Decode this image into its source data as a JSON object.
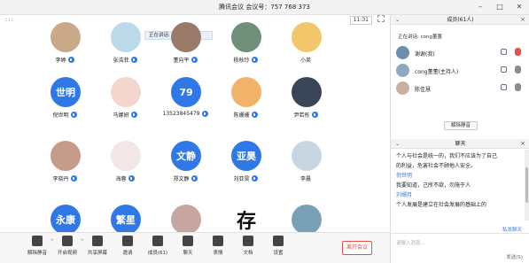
{
  "window": {
    "title": "腾讯会议 会议号：757 768 373",
    "controls": [
      "minimize-icon",
      "maximize-icon",
      "close-icon"
    ]
  },
  "video": {
    "time": "11:31",
    "speaking_bubble": "正在讲话: cong董董",
    "participants": [
      {
        "name": "李婷",
        "initial": "",
        "color": "#c9a98a",
        "mic": true
      },
      {
        "name": "张浩菲",
        "initial": "",
        "color": "#bcd9e8",
        "mic": true
      },
      {
        "name": "董向平",
        "initial": "",
        "color": "#9a7b6a",
        "mic": true
      },
      {
        "name": "杨秋玲",
        "initial": "",
        "color": "#6f8f7a",
        "mic": true
      },
      {
        "name": "小英",
        "initial": "",
        "color": "#f2c66b",
        "mic": false
      },
      {
        "name": "倪世明",
        "initial": "世明",
        "color": "#2f78e6",
        "mic": true
      },
      {
        "name": "马娜妍",
        "initial": "",
        "color": "#f4d6cf",
        "mic": true
      },
      {
        "name": "13523845479",
        "initial": "79",
        "color": "#2f78e6",
        "mic": true
      },
      {
        "name": "陈姗姗",
        "initial": "",
        "color": "#f1b36a",
        "mic": true
      },
      {
        "name": "尹若彤",
        "initial": "",
        "color": "#3a4657",
        "mic": true
      },
      {
        "name": "李晓丹",
        "initial": "",
        "color": "#c79b8a",
        "mic": true
      },
      {
        "name": "海蓉",
        "initial": "",
        "color": "#f2e6e6",
        "mic": true
      },
      {
        "name": "郑文静",
        "initial": "文静",
        "color": "#2f78e6",
        "mic": true
      },
      {
        "name": "刘亚昊",
        "initial": "亚昊",
        "color": "#2f78e6",
        "mic": true
      },
      {
        "name": "李晨",
        "initial": "",
        "color": "#c8d6e4",
        "mic": false
      },
      {
        "name": "",
        "initial": "永康",
        "color": "#2f78e6",
        "mic": false
      },
      {
        "name": "",
        "initial": "繁星",
        "color": "#2f78e6",
        "mic": false
      },
      {
        "name": "",
        "initial": "",
        "color": "#c7a5a0",
        "mic": false
      },
      {
        "name": "",
        "initial": "存",
        "color": "#ffffff",
        "mic": false
      },
      {
        "name": "",
        "initial": "",
        "color": "#7aa0b8",
        "mic": false
      }
    ]
  },
  "toolbar": {
    "items": [
      {
        "label": "解除静音",
        "icon": "mic-muted-icon"
      },
      {
        "label": "开启视频",
        "icon": "camera-off-icon"
      },
      {
        "label": "共享屏幕",
        "icon": "share-screen-icon"
      },
      {
        "label": "邀请",
        "icon": "invite-icon"
      },
      {
        "label": "成员(61)",
        "icon": "members-icon"
      },
      {
        "label": "聊天",
        "icon": "chat-icon"
      },
      {
        "label": "表情",
        "icon": "emoji-icon"
      },
      {
        "label": "文档",
        "icon": "document-icon"
      },
      {
        "label": "设置",
        "icon": "settings-icon"
      }
    ],
    "leave_label": "离开会议"
  },
  "members_panel": {
    "header": "成员(61人)",
    "speaking": "正在讲话: cong董董",
    "members": [
      {
        "name": "谢谢(我)",
        "color": "#6a8fb0",
        "mic_on": false
      },
      {
        "name": "cong董董(主持人)",
        "color": "#8fa8c0",
        "mic_on": true
      },
      {
        "name": "陈佳慧",
        "color": "#c9b0a0",
        "mic_on": true
      }
    ],
    "mute_all_label": "解除静音"
  },
  "chat_panel": {
    "header": "聊天",
    "messages": [
      {
        "who": "",
        "text": "个人与社会是统一的，我们不应该为了自己"
      },
      {
        "who": "",
        "text": "的利益，危害社会不顾他人安全。"
      },
      {
        "who": "倪世明",
        "text": ""
      },
      {
        "who": "",
        "text": "我要知道，己所不欲，勿施于人"
      },
      {
        "who": "刘姗月",
        "text": ""
      },
      {
        "who": "",
        "text": "个人发展是建立在社会发展的基础上的"
      }
    ],
    "private_chat_label": "私发聊天",
    "input_placeholder": "请输入消息...",
    "send_label": "发送(S)"
  }
}
